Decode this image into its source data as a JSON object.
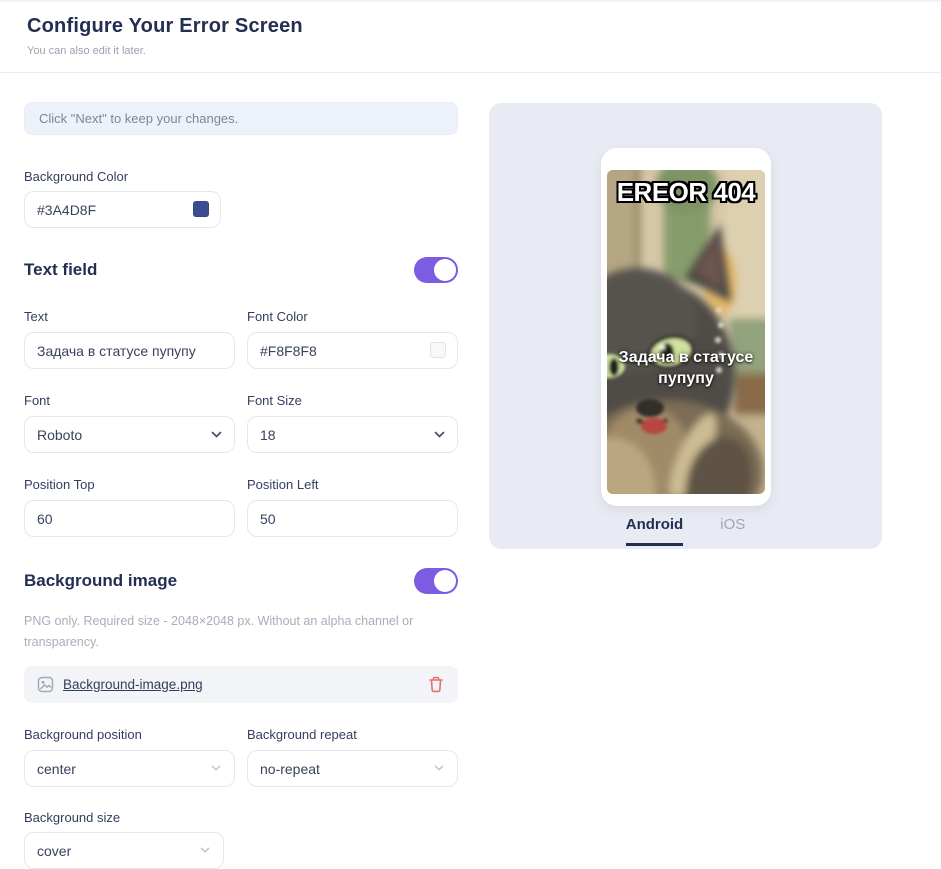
{
  "header": {
    "title": "Configure Your Error Screen",
    "subtitle": "You can also edit it later."
  },
  "notice": {
    "text": "Click \"Next\" to keep your changes."
  },
  "fields": {
    "background_color": {
      "label": "Background Color",
      "value": "#3A4D8F"
    }
  },
  "sections": {
    "text_field": {
      "title": "Text field",
      "enabled": true,
      "fields": {
        "text": {
          "label": "Text",
          "value": "Задача в статусе пупупу"
        },
        "font_color": {
          "label": "Font Color",
          "value": "#F8F8F8"
        },
        "font": {
          "label": "Font",
          "value": "Roboto"
        },
        "font_size": {
          "label": "Font Size",
          "value": "18"
        },
        "position_top": {
          "label": "Position Top",
          "value": "60"
        },
        "position_left": {
          "label": "Position Left",
          "value": "50"
        }
      }
    },
    "background_image": {
      "title": "Background image",
      "enabled": true,
      "hint": "PNG only. Required size - 2048×2048 px. Without an alpha channel or transparency.",
      "file_name": "Background-image.png",
      "fields": {
        "background_position": {
          "label": "Background position",
          "value": "center"
        },
        "background_repeat": {
          "label": "Background repeat",
          "value": "no-repeat"
        },
        "background_size": {
          "label": "Background size",
          "value": "cover"
        }
      }
    }
  },
  "preview": {
    "title": "EREOR 404",
    "overlay": "Задача в статусе пупупу",
    "tabs": [
      {
        "label": "Android",
        "active": true
      },
      {
        "label": "iOS",
        "active": false
      }
    ]
  },
  "colors": {
    "accent": "#7C5CE0",
    "danger": "#EE6B6B",
    "heading": "#232E52",
    "preview_background": "#E9EBF4",
    "notice_background": "#EDF2FA"
  }
}
